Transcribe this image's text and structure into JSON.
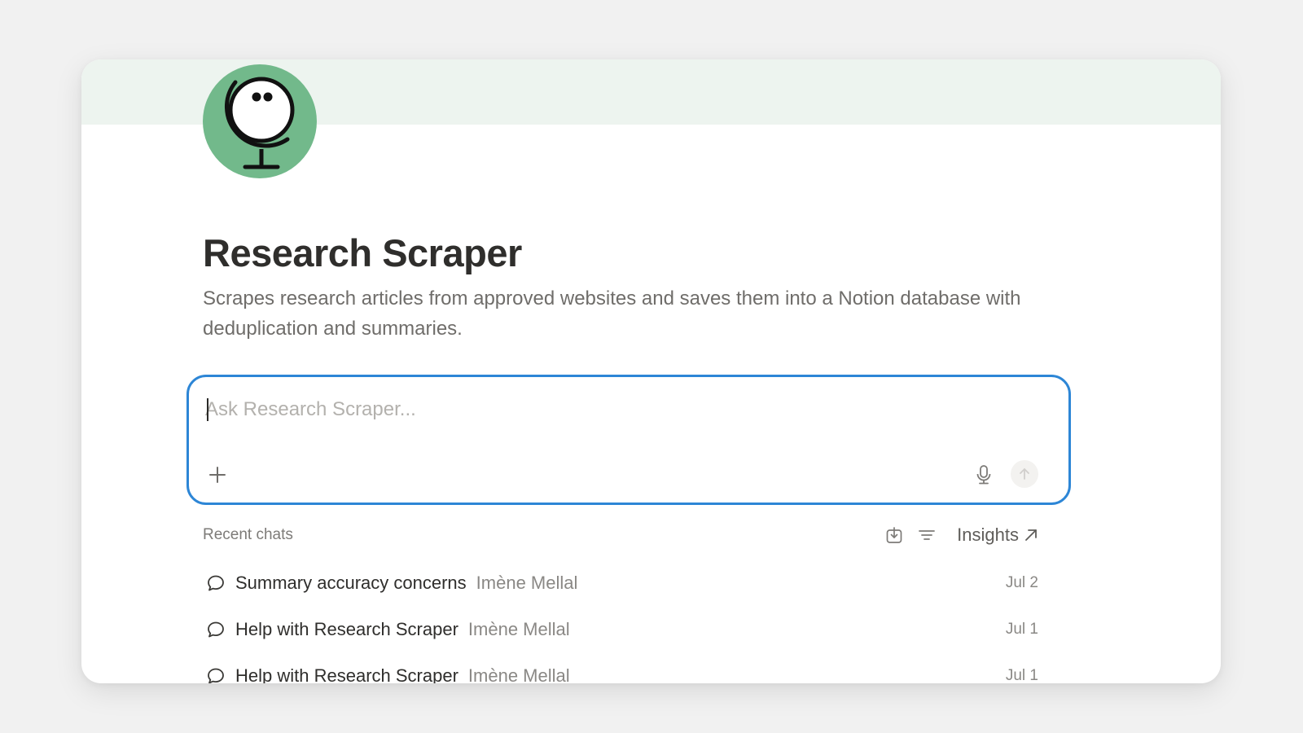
{
  "agent": {
    "name": "Research Scraper",
    "description": "Scrapes research articles from approved websites and saves them into a Notion database with deduplication and summaries.",
    "avatar_icon": "globe-face-icon",
    "avatar_color": "#72b98b"
  },
  "composer": {
    "placeholder": "Ask Research Scraper...",
    "value": "",
    "accent_color": "#2d86d6"
  },
  "recent": {
    "label": "Recent chats",
    "insights_label": "Insights",
    "chats": [
      {
        "title": "Summary accuracy concerns",
        "author": "Imène Mellal",
        "date": "Jul 2"
      },
      {
        "title": "Help with Research Scraper",
        "author": "Imène Mellal",
        "date": "Jul 1"
      },
      {
        "title": "Help with Research Scraper",
        "author": "Imène Mellal",
        "date": "Jul 1"
      }
    ]
  }
}
